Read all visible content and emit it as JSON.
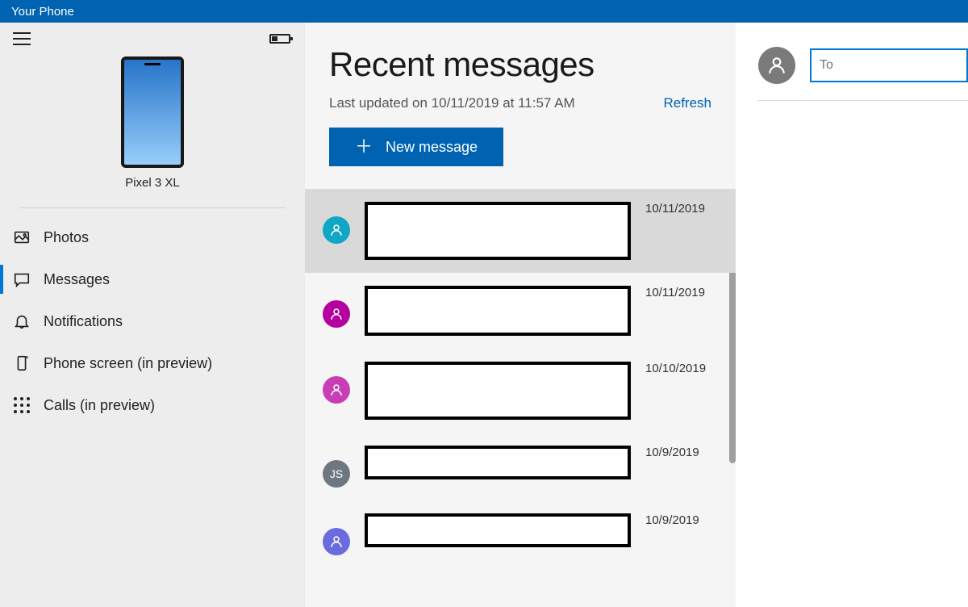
{
  "titlebar": {
    "title": "Your Phone"
  },
  "sidebar": {
    "device_name": "Pixel 3 XL",
    "nav": [
      {
        "id": "photos",
        "label": "Photos",
        "icon": "photos-icon",
        "active": false
      },
      {
        "id": "messages",
        "label": "Messages",
        "icon": "messages-icon",
        "active": true
      },
      {
        "id": "notifications",
        "label": "Notifications",
        "icon": "notifications-icon",
        "active": false
      },
      {
        "id": "phone-screen",
        "label": "Phone screen (in preview)",
        "icon": "phone-screen-icon",
        "active": false
      },
      {
        "id": "calls",
        "label": "Calls (in preview)",
        "icon": "dialpad-icon",
        "active": false
      }
    ]
  },
  "messages": {
    "title": "Recent messages",
    "last_updated": "Last updated on 10/11/2019 at 11:57 AM",
    "refresh_label": "Refresh",
    "new_message_label": "New message",
    "conversations": [
      {
        "avatar_color": "#0fa7c4",
        "avatar_text": "",
        "date": "10/11/2019",
        "redact_h": 72,
        "selected": true
      },
      {
        "avatar_color": "#b4009e",
        "avatar_text": "",
        "date": "10/11/2019",
        "redact_h": 62,
        "selected": false
      },
      {
        "avatar_color": "#c93eb4",
        "avatar_text": "",
        "date": "10/10/2019",
        "redact_h": 72,
        "selected": false
      },
      {
        "avatar_color": "#6e7780",
        "avatar_text": "JS",
        "date": "10/9/2019",
        "redact_h": 42,
        "selected": false
      },
      {
        "avatar_color": "#6b6be0",
        "avatar_text": "",
        "date": "10/9/2019",
        "redact_h": 42,
        "selected": false
      }
    ]
  },
  "compose": {
    "placeholder": "To"
  }
}
